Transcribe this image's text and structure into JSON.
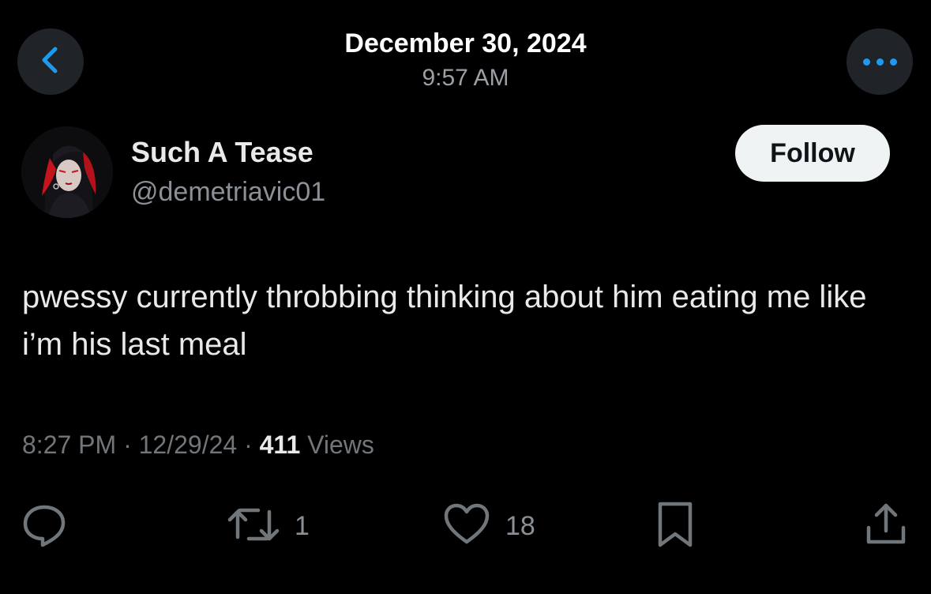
{
  "header": {
    "date": "December 30, 2024",
    "time": "9:57 AM",
    "back_icon": "chevron-left-icon",
    "more_icon": "more-horizontal-icon"
  },
  "author": {
    "display_name": "Such A Tease",
    "handle": "@demetriavic01",
    "avatar_icon": "avatar-image",
    "follow_label": "Follow"
  },
  "tweet": {
    "text": "pwessy currently throbbing thinking about him eating me like i’m his last meal",
    "posted_time": "8:27 PM",
    "posted_date": "12/29/24",
    "separator": "·",
    "views_count": "411",
    "views_label": "Views"
  },
  "actions": {
    "reply": {
      "icon": "reply-icon",
      "count": ""
    },
    "retweet": {
      "icon": "retweet-icon",
      "count": "1"
    },
    "like": {
      "icon": "heart-icon",
      "count": "18"
    },
    "bookmark": {
      "icon": "bookmark-icon"
    },
    "share": {
      "icon": "share-icon"
    }
  },
  "colors": {
    "background": "#000000",
    "accent": "#1d9bf0",
    "primary_text": "#e7e9ea",
    "secondary_text": "#71767b",
    "follow_button_bg": "#eff3f4"
  }
}
